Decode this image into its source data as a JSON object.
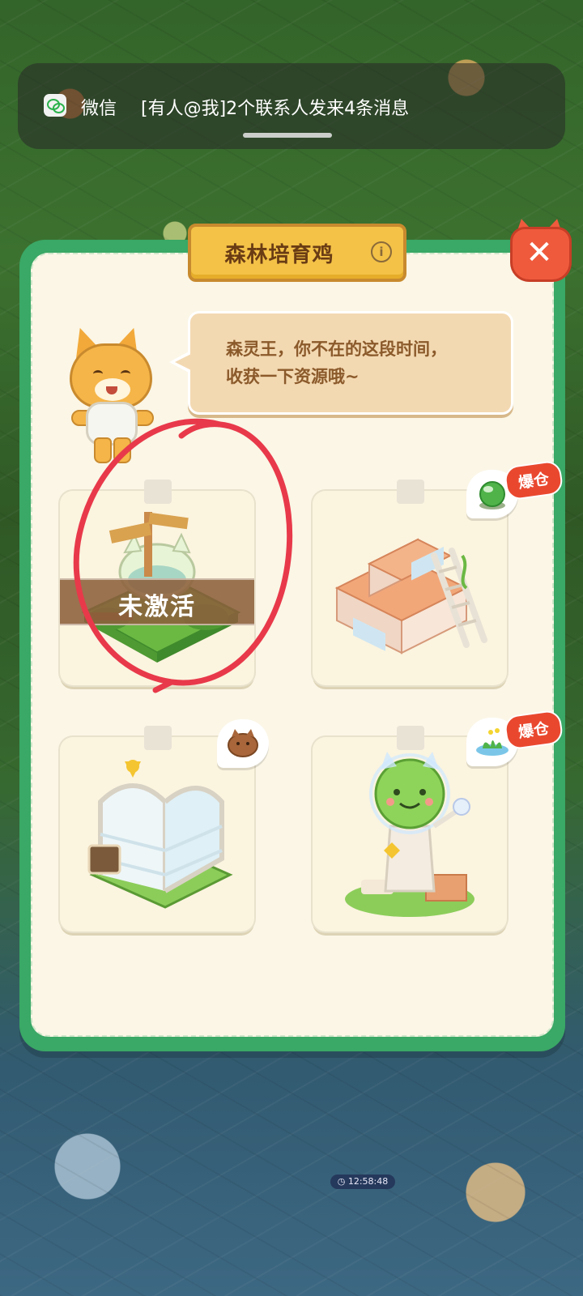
{
  "notification": {
    "app_name": "微信",
    "message": "[有人@我]2个联系人发来4条消息",
    "icon": "wechat-icon"
  },
  "modal": {
    "title": "森林培育鸡",
    "info_icon": "info-icon",
    "close_icon": "close-icon",
    "speech_line1": "森灵王，你不在的这段时间，",
    "speech_line2": "收获一下资源哦~"
  },
  "cards": [
    {
      "name": "forest-garden",
      "status_label": "未激活",
      "active": false
    },
    {
      "name": "storage-building",
      "resource_icon": "green-orb-icon",
      "badge": "爆仓"
    },
    {
      "name": "glass-shelf",
      "resource_icon": "bread-icon"
    },
    {
      "name": "slime-statue",
      "resource_icon": "herb-icon",
      "badge": "爆仓"
    }
  ],
  "hud": {
    "timer": "12:58:48"
  },
  "colors": {
    "panel_border": "#3aa866",
    "panel_bg": "#fbf6e6",
    "title_bg": "#f3c247",
    "close_red": "#ef5a3d",
    "badge_red": "#e9482f",
    "annotation_red": "#e8394a"
  }
}
